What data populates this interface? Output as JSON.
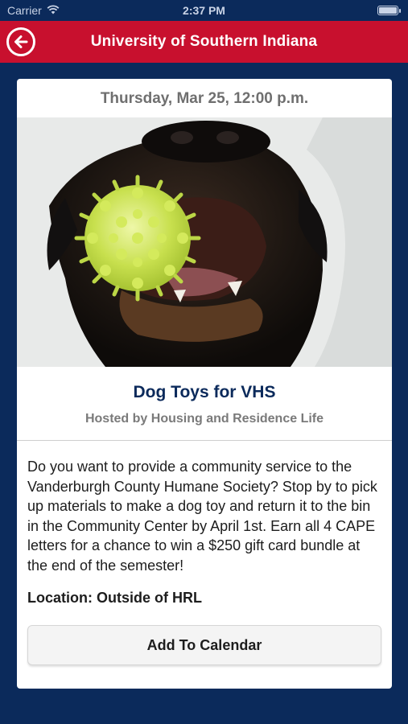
{
  "status_bar": {
    "carrier": "Carrier",
    "time": "2:37 PM"
  },
  "nav": {
    "title": "University of Southern Indiana"
  },
  "event": {
    "date": "Thursday, Mar 25, 12:00 p.m.",
    "title": "Dog Toys for VHS",
    "host": "Hosted by Housing and Residence Life",
    "description": "Do you want to provide a community service to the Vanderburgh County Humane Society? Stop by to pick up materials to make a dog toy and return it to the bin in the Community Center by April 1st. Earn all 4 CAPE letters for a chance to win a $250 gift card bundle at the end of the semester!",
    "location": "Location: Outside of HRL",
    "add_to_calendar_label": "Add To Calendar"
  },
  "colors": {
    "brand_red": "#c8102e",
    "brand_navy": "#0b2a5b",
    "card_bg": "#ffffff"
  },
  "icons": {
    "back": "back-arrow-circle-icon",
    "wifi": "wifi-icon",
    "battery": "battery-icon"
  }
}
